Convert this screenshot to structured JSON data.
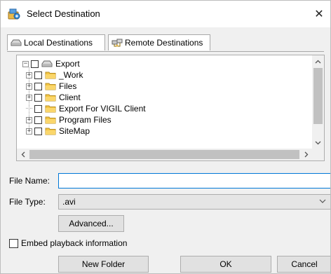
{
  "window": {
    "title": "Select Destination",
    "close_symbol": "✕"
  },
  "tabs": [
    {
      "label": "Local Destinations",
      "icon": "drive-icon",
      "active": true
    },
    {
      "label": "Remote Destinations",
      "icon": "network-icon",
      "active": false
    }
  ],
  "tree": {
    "root": {
      "label": "Export",
      "expander": "−",
      "checked": false
    },
    "children": [
      {
        "label": "_Work",
        "expander": "+",
        "checked": false
      },
      {
        "label": "Files",
        "expander": "+",
        "checked": false
      },
      {
        "label": "Client",
        "expander": "+",
        "checked": false
      },
      {
        "label": "Export For VIGIL Client",
        "expander": "",
        "checked": false
      },
      {
        "label": "Program Files",
        "expander": "+",
        "checked": false
      },
      {
        "label": "SiteMap",
        "expander": "+",
        "checked": false
      }
    ]
  },
  "form": {
    "file_name_label": "File Name:",
    "file_name_value": "",
    "file_type_label": "File Type:",
    "file_type_value": ".avi",
    "advanced_label": "Advanced...",
    "embed_label": "Embed playback information",
    "embed_checked": false
  },
  "buttons": {
    "new_folder": "New Folder",
    "ok": "OK",
    "cancel": "Cancel"
  },
  "colors": {
    "folder": "#f4c542",
    "focus": "#0078d7",
    "dialog_bg": "#f0f0f0"
  }
}
